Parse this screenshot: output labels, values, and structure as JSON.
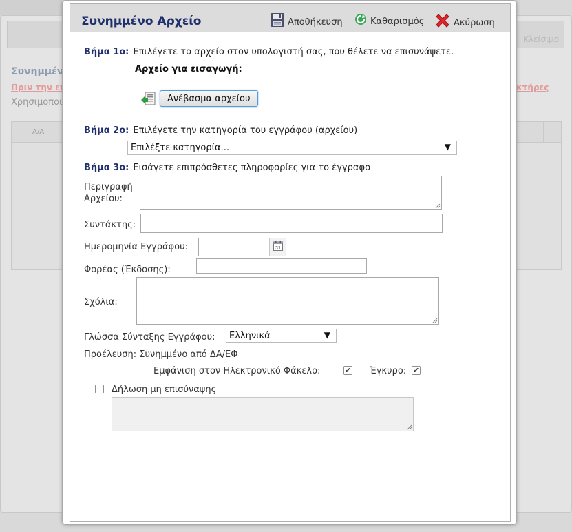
{
  "background": {
    "close_label": "Κλείσιμο",
    "title": "Συνημμέν",
    "warning_left": "Πριν την επ",
    "warning_right": "ακτήρες",
    "text": "Χρησιμοποι",
    "table_header": "Α/Α"
  },
  "dialog": {
    "title": "Συνημμένο Αρχείο",
    "toolbar": {
      "save_label": "Αποθήκευση",
      "clear_label": "Καθαρισμός",
      "cancel_label": "Ακύρωση",
      "save_icon": "floppy-disk-icon",
      "clear_icon": "refresh-icon",
      "cancel_icon": "red-x-icon"
    },
    "step1": {
      "heading": "Βήμα 1ο:",
      "text": "Επιλέγετε το αρχείο στον υπολογιστή σας, που θέλετε να επισυνάψετε.",
      "file_label": "Αρχείο για εισαγωγή:",
      "upload_button": "Ανέβασμα αρχείου",
      "upload_icon": "upload-file-icon"
    },
    "step2": {
      "heading": "Βήμα 2ο:",
      "text": "Επιλέγετε την κατηγορία του εγγράφου (αρχείου)",
      "category_select": "Επιλέξτε κατηγορία..."
    },
    "step3": {
      "heading": "Βήμα 3ο:",
      "text": "Εισάγετε επιπρόσθετες πληροφορίες για το έγγραφο"
    },
    "fields": {
      "description_label_line1": "Περιγραφή",
      "description_label_line2": "Αρχείου:",
      "description_value": "",
      "author_label": "Συντάκτης:",
      "author_value": "",
      "date_label": "Ημερομηνία Εγγράφου:",
      "date_value": "",
      "calendar_icon": "calendar-icon",
      "issuer_label": "Φορέας (Έκδοσης):",
      "issuer_value": "",
      "comments_label": "Σχόλια:",
      "comments_value": "",
      "language_label": "Γλώσσα Σύνταξης Εγγράφου:",
      "language_value": "Ελληνικά",
      "origin_label": "Προέλευση:",
      "origin_value": "Συνημμένο από ΔΑ/ΕΦ",
      "show_in_folder_label": "Εμφάνιση στον Ηλεκτρονικό Φάκελο:",
      "show_in_folder_checked": true,
      "valid_label": "Έγκυρο:",
      "valid_checked": true,
      "no_attach_label": "Δήλωση μη επισύναψης",
      "no_attach_checked": false,
      "no_attach_reason": ""
    }
  }
}
